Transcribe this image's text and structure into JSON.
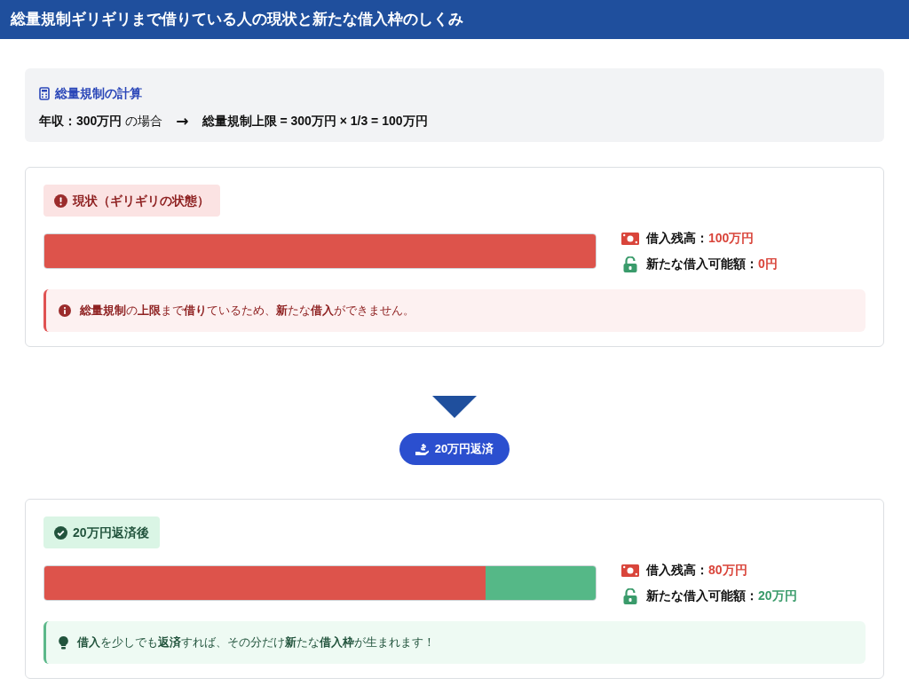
{
  "title": "総量規制ギリギリまで借りている人の現状と新たな借入枠のしくみ",
  "calc": {
    "heading": "総量規制の計算",
    "income": "**年収：300万円** の場合",
    "arrow": "→",
    "formula": "総量規制上限 = 300万円 × 1/3 = 100万円"
  },
  "states": [
    {
      "kind": "warning",
      "badge": "現状（ギリギリの状態）",
      "level": 1.0,
      "stats": [
        {
          "kind": "balance",
          "label": "借入残高：",
          "value": "100万円",
          "color": "#d9453b"
        },
        {
          "kind": "available",
          "label": "新たな借入可能額：",
          "value": "0円",
          "color": "#d9453b"
        }
      ],
      "note": "**総量規制**の**上限**まで**借り**ているため、**新**たな**借入**ができません。"
    },
    {
      "kind": "success",
      "badge": "20万円返済後",
      "level": 0.8,
      "stats": [
        {
          "kind": "balance",
          "label": "借入残高：",
          "value": "80万円",
          "color": "#d9453b"
        },
        {
          "kind": "available",
          "label": "新たな借入可能額：",
          "value": "20万円",
          "color": "#3a9b6b"
        }
      ],
      "note": "**借入**を少しでも**返済**すれば、その分だけ**新**たな**借入枠**が生まれます！"
    }
  ],
  "step": {
    "label": "20万円返済"
  }
}
